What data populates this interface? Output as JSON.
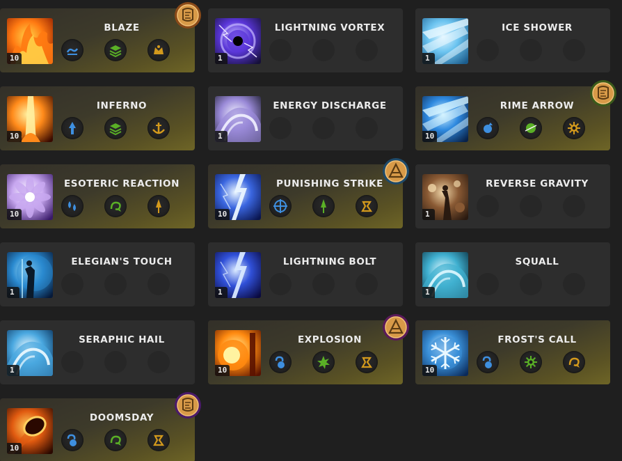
{
  "skills": [
    {
      "name": "BLAZE",
      "level": "10",
      "theme": "fire",
      "active": true,
      "badge": {
        "rune": "scroll-rune-icon",
        "ring": "#8a4a18"
      },
      "modifiers": [
        {
          "icon": "wave-icon",
          "color": "#3e8fe0"
        },
        {
          "icon": "stack-layers-icon",
          "color": "#5ab026"
        },
        {
          "icon": "crown-swirl-icon",
          "color": "#d49a1c"
        }
      ]
    },
    {
      "name": "LIGHTNING VORTEX",
      "level": "1",
      "theme": "vortex",
      "active": false,
      "modifiers": []
    },
    {
      "name": "ICE SHOWER",
      "level": "1",
      "theme": "ice-shower",
      "active": false,
      "modifiers": []
    },
    {
      "name": "INFERNO",
      "level": "10",
      "theme": "inferno",
      "active": true,
      "modifiers": [
        {
          "icon": "arrow-up-icon",
          "color": "#3e8fe0"
        },
        {
          "icon": "stack-layers-icon",
          "color": "#5ab026"
        },
        {
          "icon": "anchor-icon",
          "color": "#d49a1c"
        }
      ]
    },
    {
      "name": "ENERGY DISCHARGE",
      "level": "1",
      "theme": "discharge",
      "active": false,
      "modifiers": []
    },
    {
      "name": "RIME ARROW",
      "level": "10",
      "theme": "rime",
      "active": true,
      "badge": {
        "rune": "scroll-rune-icon",
        "ring": "#3a5a1a"
      },
      "modifiers": [
        {
          "icon": "orb-up-icon",
          "color": "#3e8fe0"
        },
        {
          "icon": "orb-slash-icon",
          "color": "#5ab026"
        },
        {
          "icon": "sun-burst-icon",
          "color": "#d49a1c"
        }
      ]
    },
    {
      "name": "ESOTERIC REACTION",
      "level": "10",
      "theme": "esoteric",
      "active": true,
      "modifiers": [
        {
          "icon": "double-drop-icon",
          "color": "#3e8fe0"
        },
        {
          "icon": "swirl-arrow-icon",
          "color": "#5ab026"
        },
        {
          "icon": "spire-icon",
          "color": "#d49a1c"
        }
      ]
    },
    {
      "name": "PUNISHING STRIKE",
      "level": "10",
      "theme": "punish",
      "active": true,
      "badge": {
        "rune": "triangle-rune-icon",
        "ring": "#1e4a6a"
      },
      "modifiers": [
        {
          "icon": "target-cross-icon",
          "color": "#3e8fe0"
        },
        {
          "icon": "spire-icon",
          "color": "#5ab026"
        },
        {
          "icon": "rune-glyph-icon",
          "color": "#d49a1c"
        }
      ]
    },
    {
      "name": "REVERSE GRAVITY",
      "level": "1",
      "theme": "gravity",
      "active": false,
      "modifiers": []
    },
    {
      "name": "ELEGIAN'S TOUCH",
      "level": "1",
      "theme": "elegian",
      "active": false,
      "modifiers": []
    },
    {
      "name": "LIGHTNING BOLT",
      "level": "1",
      "theme": "bolt",
      "active": false,
      "modifiers": []
    },
    {
      "name": "SQUALL",
      "level": "1",
      "theme": "squall",
      "active": false,
      "modifiers": []
    },
    {
      "name": "SERAPHIC HAIL",
      "level": "1",
      "theme": "hail",
      "active": false,
      "modifiers": []
    },
    {
      "name": "EXPLOSION",
      "level": "10",
      "theme": "explosion",
      "active": true,
      "badge": {
        "rune": "triangle-rune-icon",
        "ring": "#5a1a5a"
      },
      "modifiers": [
        {
          "icon": "hook-orb-icon",
          "color": "#3e8fe0"
        },
        {
          "icon": "burst-icon",
          "color": "#5ab026"
        },
        {
          "icon": "rune-glyph-icon",
          "color": "#d49a1c"
        }
      ]
    },
    {
      "name": "FROST'S CALL",
      "level": "10",
      "theme": "frost",
      "active": true,
      "modifiers": [
        {
          "icon": "hook-orb-icon",
          "color": "#3e8fe0"
        },
        {
          "icon": "sun-burst-icon",
          "color": "#5ab026"
        },
        {
          "icon": "swirl-arrow-icon",
          "color": "#d49a1c"
        }
      ]
    },
    {
      "name": "DOOMSDAY",
      "level": "10",
      "theme": "doomsday",
      "active": true,
      "badge": {
        "rune": "scroll-rune-icon",
        "ring": "#4a1a6a"
      },
      "modifiers": [
        {
          "icon": "hook-orb-icon",
          "color": "#3e8fe0"
        },
        {
          "icon": "swirl-arrow-icon",
          "color": "#5ab026"
        },
        {
          "icon": "rune-glyph-icon",
          "color": "#d49a1c"
        }
      ]
    }
  ]
}
